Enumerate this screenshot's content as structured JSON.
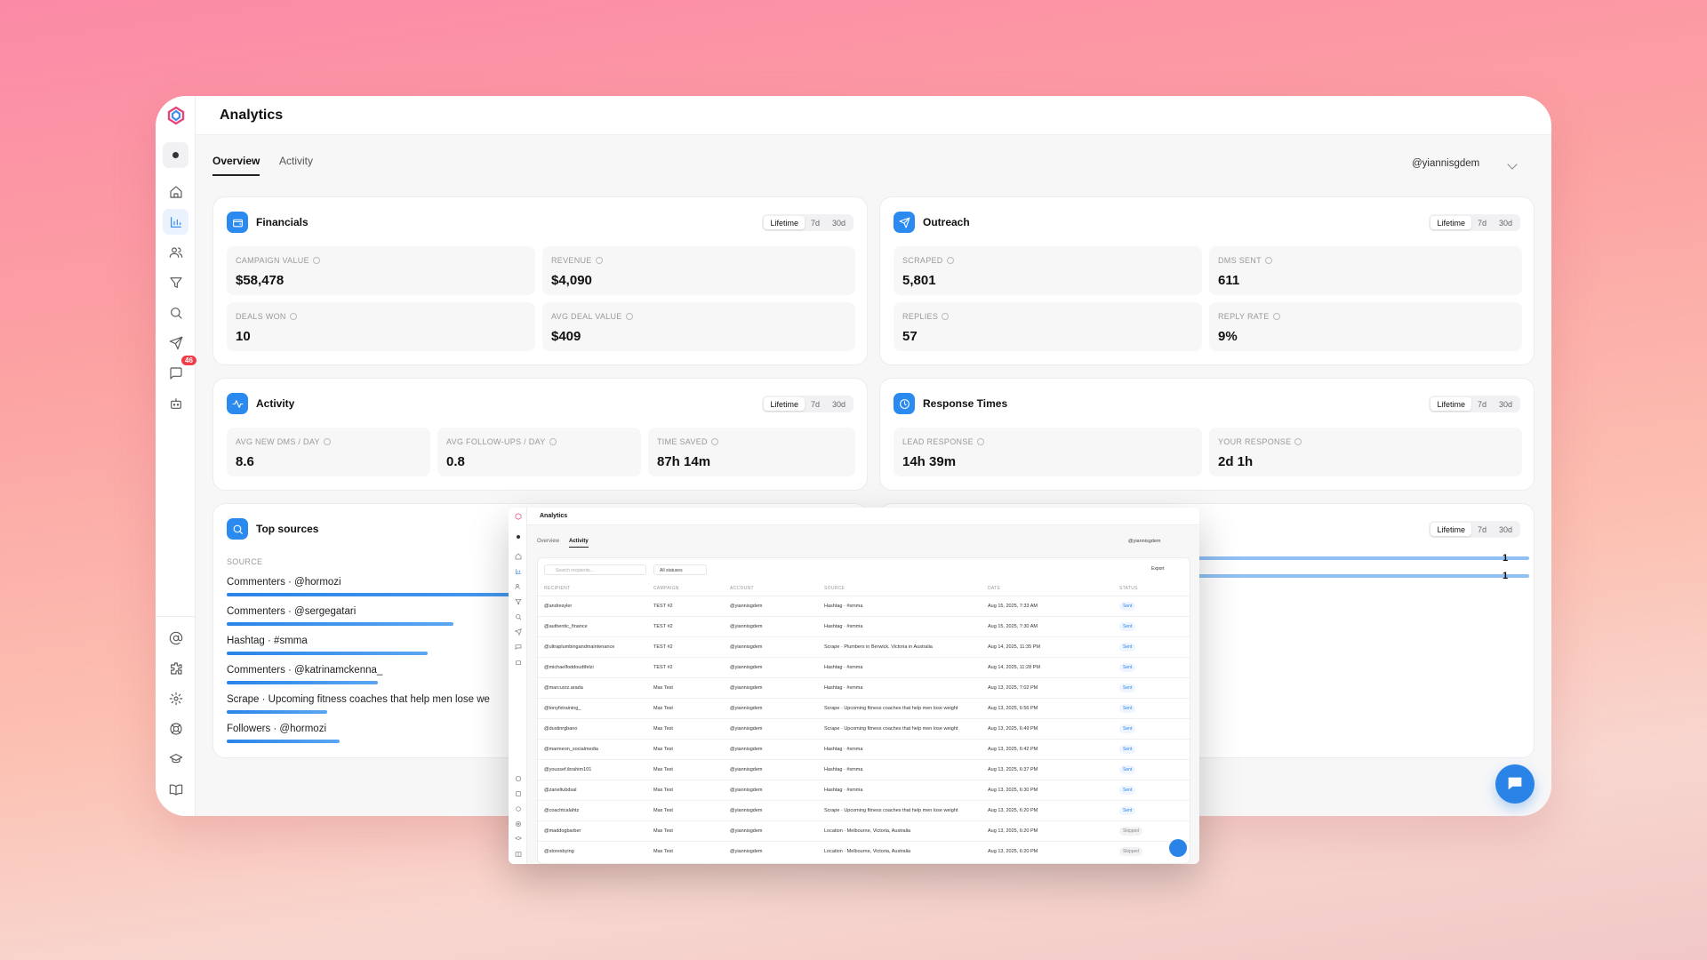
{
  "app": {
    "title": "Analytics",
    "tabs": [
      {
        "label": "Overview"
      },
      {
        "label": "Activity"
      }
    ],
    "account": "@yiannisgdem",
    "chat_badge": "46"
  },
  "ranges": [
    "Lifetime",
    "7d",
    "30d"
  ],
  "financials": {
    "title": "Financials",
    "metrics": [
      {
        "label": "CAMPAIGN VALUE",
        "value": "$58,478"
      },
      {
        "label": "REVENUE",
        "value": "$4,090"
      },
      {
        "label": "DEALS WON",
        "value": "10"
      },
      {
        "label": "AVG DEAL VALUE",
        "value": "$409"
      }
    ]
  },
  "outreach": {
    "title": "Outreach",
    "metrics": [
      {
        "label": "SCRAPED",
        "value": "5,801"
      },
      {
        "label": "DMS SENT",
        "value": "611"
      },
      {
        "label": "REPLIES",
        "value": "57"
      },
      {
        "label": "REPLY RATE",
        "value": "9%"
      }
    ]
  },
  "activity": {
    "title": "Activity",
    "metrics": [
      {
        "label": "AVG NEW DMS / DAY",
        "value": "8.6"
      },
      {
        "label": "AVG FOLLOW-UPS / DAY",
        "value": "0.8"
      },
      {
        "label": "TIME SAVED",
        "value": "87h 14m"
      }
    ]
  },
  "response_times": {
    "title": "Response Times",
    "metrics": [
      {
        "label": "LEAD RESPONSE",
        "value": "14h 39m"
      },
      {
        "label": "YOUR RESPONSE",
        "value": "2d 1h"
      }
    ]
  },
  "top_sources": {
    "title": "Top sources",
    "col": "SOURCE",
    "items": [
      {
        "label": "Commenters · @hormozi",
        "share": 0.8
      },
      {
        "label": "Commenters · @sergegatari",
        "share": 0.36
      },
      {
        "label": "Hashtag · #smma",
        "share": 0.32
      },
      {
        "label": "Commenters · @katrinamckenna_",
        "share": 0.24
      },
      {
        "label": "Scrape · Upcoming fitness coaches that help men lose we",
        "share": 0.16
      },
      {
        "label": "Followers · @hormozi",
        "share": 0.18
      }
    ]
  },
  "right_card": {
    "rows": [
      {
        "value": "1"
      },
      {
        "value": "1"
      }
    ]
  },
  "mini": {
    "title": "Analytics",
    "tabs": [
      "Overview",
      "Activity"
    ],
    "account": "@yiannisgdem",
    "search_placeholder": "Search recipients...",
    "status_filter": "All statuses",
    "export": "Export",
    "headers": [
      "RECIPIENT",
      "CAMPAIGN",
      "ACCOUNT",
      "SOURCE",
      "DATE",
      "STATUS"
    ],
    "rows": [
      {
        "recipient": "@andresyler",
        "campaign": "TEST #2",
        "account": "@yiannisgdem",
        "source": "Hashtag · #smma",
        "date": "Aug 15, 2025, 7:33 AM",
        "status": "Sent"
      },
      {
        "recipient": "@authentic_finance",
        "campaign": "TEST #2",
        "account": "@yiannisgdem",
        "source": "Hashtag · #smma",
        "date": "Aug 15, 2025, 7:30 AM",
        "status": "Sent"
      },
      {
        "recipient": "@ultraplumbingandmaintenance",
        "campaign": "TEST #2",
        "account": "@yiannisgdem",
        "source": "Scrape · Plumbers in Berwick, Victoria in Australia",
        "date": "Aug 14, 2025, 11:35 PM",
        "status": "Sent"
      },
      {
        "recipient": "@michaelfoddoudtfelzi",
        "campaign": "TEST #2",
        "account": "@yiannisgdem",
        "source": "Hashtag · #smma",
        "date": "Aug 14, 2025, 11:28 PM",
        "status": "Sent"
      },
      {
        "recipient": "@marcusrz.arada",
        "campaign": "Max Test",
        "account": "@yiannisgdem",
        "source": "Hashtag · #smma",
        "date": "Aug 13, 2025, 7:02 PM",
        "status": "Sent"
      },
      {
        "recipient": "@tonyfxtraining_",
        "campaign": "Max Test",
        "account": "@yiannisgdem",
        "source": "Scrape · Upcoming fitness coaches that help men lose weight",
        "date": "Aug 13, 2025, 6:56 PM",
        "status": "Sent"
      },
      {
        "recipient": "@dustinrgbano",
        "campaign": "Max Test",
        "account": "@yiannisgdem",
        "source": "Scrape · Upcoming fitness coaches that help men lose weight",
        "date": "Aug 13, 2025, 6:49 PM",
        "status": "Sent"
      },
      {
        "recipient": "@marmeon_socialmedia",
        "campaign": "Max Test",
        "account": "@yiannisgdem",
        "source": "Hashtag · #smma",
        "date": "Aug 13, 2025, 6:42 PM",
        "status": "Sent"
      },
      {
        "recipient": "@youssef.ibrahim101",
        "campaign": "Max Test",
        "account": "@yiannisgdem",
        "source": "Hashtag · #smma",
        "date": "Aug 13, 2025, 6:37 PM",
        "status": "Sent"
      },
      {
        "recipient": "@zaneltubdsal",
        "campaign": "Max Test",
        "account": "@yiannisgdem",
        "source": "Hashtag · #smma",
        "date": "Aug 13, 2025, 6:30 PM",
        "status": "Sent"
      },
      {
        "recipient": "@coachtcalahtz",
        "campaign": "Max Test",
        "account": "@yiannisgdem",
        "source": "Scrape · Upcoming fitness coaches that help men lose weight",
        "date": "Aug 13, 2025, 6:20 PM",
        "status": "Sent"
      },
      {
        "recipient": "@maddogbarber",
        "campaign": "Max Test",
        "account": "@yiannisgdem",
        "source": "Location · Melbourne, Victoria, Australia",
        "date": "Aug 13, 2025, 6:20 PM",
        "status": "Skipped"
      },
      {
        "recipient": "@storesbying",
        "campaign": "Max Test",
        "account": "@yiannisgdem",
        "source": "Location · Melbourne, Victoria, Australia",
        "date": "Aug 13, 2025, 6:20 PM",
        "status": "Skipped"
      }
    ]
  }
}
